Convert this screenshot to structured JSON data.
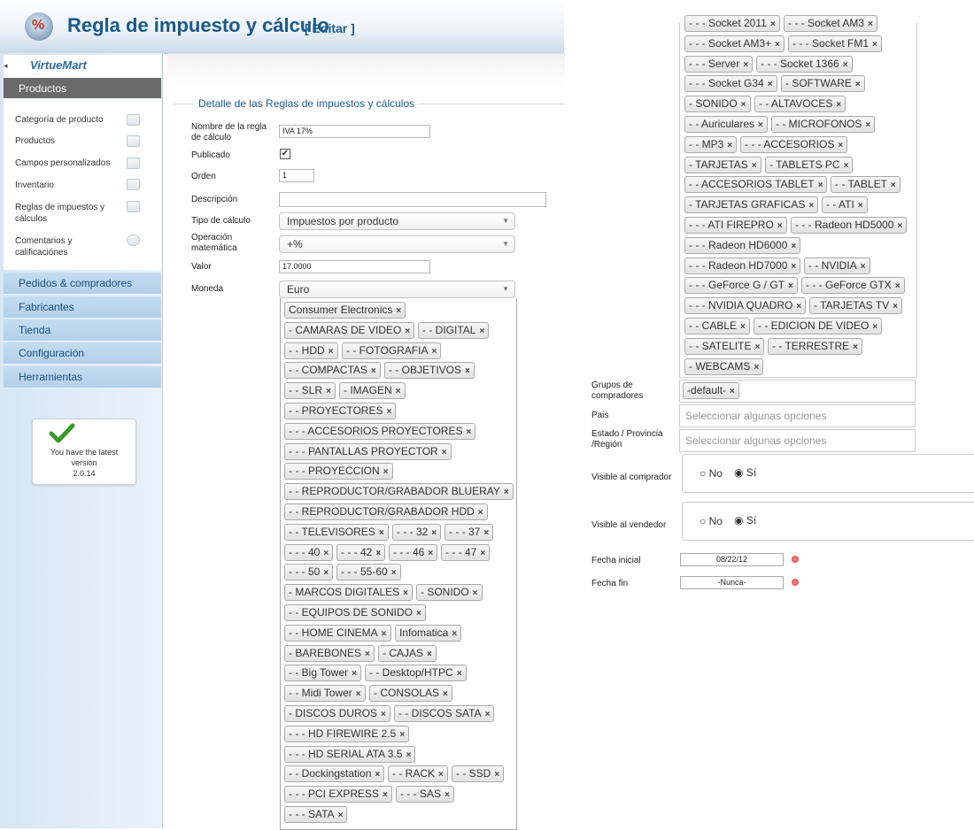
{
  "header": {
    "title": "Regla de impuesto y cálculo",
    "edit_link": "[ Editar ]"
  },
  "sidebar": {
    "logo": "VirtueMart",
    "menu": {
      "productos": "Productos",
      "pedidos": "Pedidos & compradores",
      "fabricantes": "Fabricantes",
      "tienda": "Tienda",
      "configuracion": "Configuración",
      "herramientas": "Herramientas"
    },
    "submenu": [
      "Categoría de producto",
      "Productos",
      "Campos personalizados",
      "Inventario",
      "Reglas de impuestos y cálculos",
      "Comentarios y calificaciónes"
    ],
    "version_box": {
      "line1": "You have the latest",
      "line2": "version",
      "line3": "2.0.14"
    }
  },
  "form": {
    "legend": "Detalle de las Reglas de impuestos y cálculos",
    "labels": {
      "nombre": "Nombre de la regla de cálculo",
      "publicado": "Publicado",
      "orden": "Orden",
      "descripcion": "Descripción",
      "tipo": "Tipo de cálculo",
      "operacion": "Operación matemática",
      "valor": "Valor",
      "moneda": "Moneda"
    },
    "values": {
      "nombre": "IVA 17%",
      "publicado_checked": "✓",
      "orden": "1",
      "descripcion": "",
      "tipo": "Impuestos por producto",
      "operacion": "+%",
      "valor": "17.0000",
      "moneda": "Euro"
    }
  },
  "category_tags": [
    "Consumer Electronics",
    "- CAMARAS DE VIDEO",
    "- - DIGITAL",
    "- - HDD",
    "- - FOTOGRAFIA",
    "- - COMPACTAS",
    "- - OBJETIVOS",
    "- - SLR",
    "- IMAGEN",
    "- - PROYECTORES",
    "- - - ACCESORIOS PROYECTORES",
    "- - - PANTALLAS PROYECTOR",
    "- - - PROYECCION",
    "- - REPRODUCTOR/GRABADOR BLUERAY",
    "- - REPRODUCTOR/GRABADOR HDD",
    "- - TELEVISORES",
    "- - - 32",
    "- - - 37",
    "- - - 40",
    "- - - 42",
    "- - - 46",
    "- - - 47",
    "- - - 50",
    "- - - 55-60",
    "- MARCOS DIGITALES",
    "- SONIDO",
    "- - EQUIPOS DE SONIDO",
    "- - HOME CINEMA",
    "Infomatica",
    "- BAREBONES",
    "- CAJAS",
    "- - Big Tower",
    "- - Desktop/HTPC",
    "- - Midi Tower",
    "- CONSOLAS",
    "- DISCOS DUROS",
    "- - DISCOS SATA",
    "- - - HD FIREWIRE 2.5",
    "- - - HD SERIAL ATA 3.5",
    "- - Dockingstation",
    "- - RACK",
    "- - SSD",
    "- - - PCI EXPRESS",
    "- - - SAS",
    "- - - SATA"
  ],
  "right_tags": [
    "- - - Socket 2011",
    "- - - Socket AM3",
    "- - - Socket AM3+",
    "- - - Socket FM1",
    "- - - Server",
    "- - - Socket 1366",
    "- - - Socket G34",
    "- SOFTWARE",
    "- SONIDO",
    "- - ALTAVOCES",
    "- - Auriculares",
    "- - MICROFONOS",
    "- - MP3",
    "- - - ACCESORIOS",
    "- TARJETAS",
    "- TABLETS PC",
    "- - ACCESORIOS TABLET",
    "- - TABLET",
    "- TARJETAS GRAFICAS",
    "- - ATI",
    "- - - ATI FIREPRO",
    "- - - Radeon HD5000",
    "- - - Radeon HD6000",
    "- - - Radeon HD7000",
    "- - NVIDIA",
    "- - - GeForce G / GT",
    "- - - GeForce GTX",
    "- - - NVIDIA QUADRO",
    "- TARJETAS TV",
    "- - CABLE",
    "- - EDICION DE VIDEO",
    "- - SATELITE",
    "- - TERRESTRE",
    "- WEBCAMS"
  ],
  "right_form": {
    "grupos_label": "Grupos de compradores",
    "grupos_tag": "-default-",
    "pais_label": "Pais",
    "pais_placeholder": "Seleccionar algunas opciones",
    "estado_label": "Estado / Provincia /Región",
    "estado_placeholder": "Seleccionar algunas opciones",
    "visible_comprador_label": "Visible al comprador",
    "visible_vendedor_label": "Visible al vendedor",
    "radio_no": "No",
    "radio_si": "Sí",
    "fecha_inicial_label": "Fecha inicial",
    "fecha_inicial": "08/22/12",
    "fecha_fin_label": "Fecha fin",
    "fecha_fin": "-Nunca-"
  }
}
